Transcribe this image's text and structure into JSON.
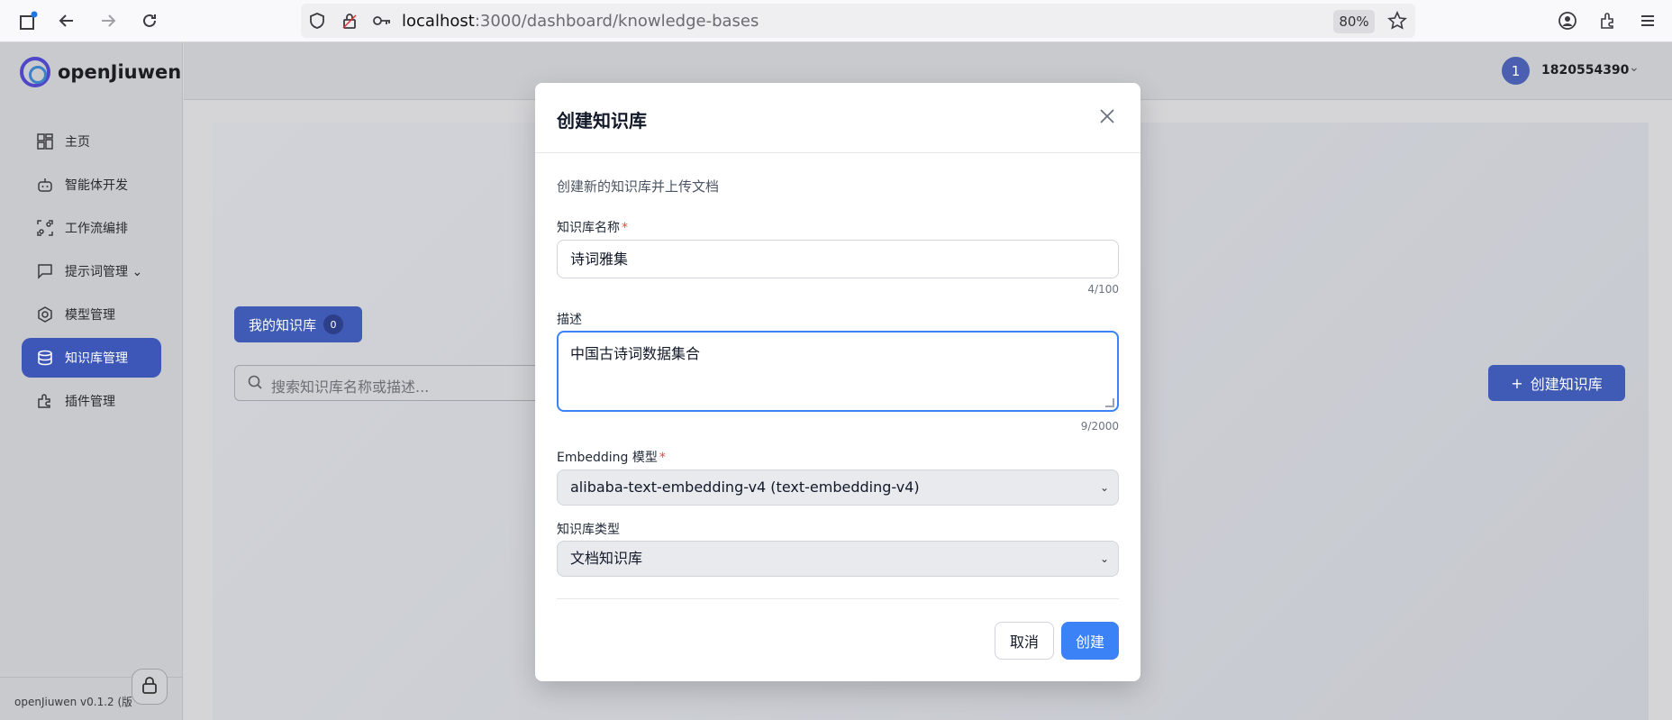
{
  "browser": {
    "url_host": "localhost",
    "url_path": ":3000/dashboard/knowledge-bases",
    "zoom": "80%",
    "icons": [
      "new-tab-icon",
      "back-icon",
      "forward-icon",
      "reload-icon",
      "shield-icon",
      "lock-icon",
      "key-icon",
      "star-icon",
      "account-icon",
      "extensions-icon",
      "menu-icon"
    ]
  },
  "brand": {
    "name": "openJiuwen"
  },
  "sidebar": {
    "items": [
      {
        "label": "主页",
        "icon": "dashboard-icon"
      },
      {
        "label": "智能体开发",
        "icon": "robot-icon"
      },
      {
        "label": "工作流编排",
        "icon": "workflow-icon"
      },
      {
        "label": "提示词管理 ⌄",
        "icon": "chat-icon"
      },
      {
        "label": "模型管理",
        "icon": "model-icon"
      },
      {
        "label": "知识库管理",
        "icon": "database-icon",
        "active": true
      },
      {
        "label": "插件管理",
        "icon": "plugin-icon"
      }
    ],
    "version": "openJiuwen v0.1.2 (版本"
  },
  "header": {
    "avatar_initial": "1",
    "username": "1820554390"
  },
  "page": {
    "tab_mine": "我的知识库",
    "tab_mine_count": "0",
    "search_placeholder": "搜索知识库名称或描述...",
    "create_button": "创建知识库",
    "create_button_plus": "+"
  },
  "modal": {
    "title": "创建知识库",
    "subtitle": "创建新的知识库并上传文档",
    "name_label": "知识库名称",
    "name_value": "诗词雅集",
    "name_counter": "4/100",
    "desc_label": "描述",
    "desc_value": "中国古诗词数据集合",
    "desc_counter": "9/2000",
    "embedding_label": "Embedding 模型",
    "embedding_value": "alibaba-text-embedding-v4 (text-embedding-v4)",
    "type_label": "知识库类型",
    "type_value": "文档知识库",
    "required_mark": "*",
    "cancel": "取消",
    "create": "创建"
  },
  "colors": {
    "accent": "#3b82f6",
    "sidebar_active": "#3d57b8",
    "required": "#ef4444"
  }
}
